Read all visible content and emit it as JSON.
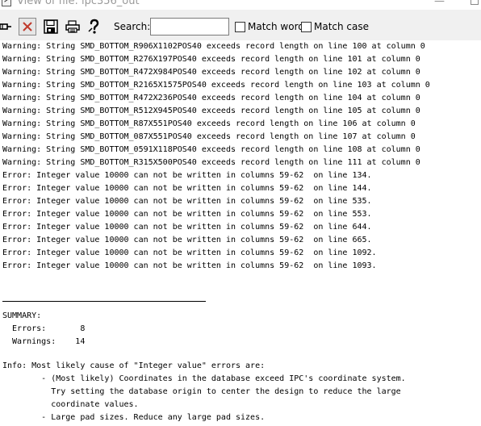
{
  "window": {
    "title": "View of file: ipc356_out",
    "minimize_glyph": "—"
  },
  "toolbar": {
    "icons": [
      "dock-icon",
      "close-icon",
      "save-icon",
      "print-icon",
      "help-icon"
    ],
    "search_label": "Search:",
    "search_value": "",
    "match_word_label": "Match word",
    "match_word_checked": false,
    "match_case_label": "Match case",
    "match_case_checked": false
  },
  "log": {
    "warnings": [
      "Warning: String SMD_BOTTOM_R906X1102POS40 exceeds record length on line 100 at column 0",
      "Warning: String SMD_BOTTOM_R276X197POS40 exceeds record length on line 101 at column 0",
      "Warning: String SMD_BOTTOM_R472X984POS40 exceeds record length on line 102 at column 0",
      "Warning: String SMD_BOTTOM_R2165X1575POS40 exceeds record length on line 103 at column 0",
      "Warning: String SMD_BOTTOM_R472X236POS40 exceeds record length on line 104 at column 0",
      "Warning: String SMD_BOTTOM_R512X945POS40 exceeds record length on line 105 at column 0",
      "Warning: String SMD_BOTTOM_R87X551POS40 exceeds record length on line 106 at column 0",
      "Warning: String SMD_BOTTOM_087X551POS40 exceeds record length on line 107 at column 0",
      "Warning: String SMD_BOTTOM_0591X118POS40 exceeds record length on line 108 at column 0",
      "Warning: String SMD_BOTTOM_R315X500POS40 exceeds record length on line 111 at column 0"
    ],
    "errors": [
      "Error: Integer value 10000 can not be written in columns 59-62  on line 134.",
      "Error: Integer value 10000 can not be written in columns 59-62  on line 144.",
      "Error: Integer value 10000 can not be written in columns 59-62  on line 535.",
      "Error: Integer value 10000 can not be written in columns 59-62  on line 553.",
      "Error: Integer value 10000 can not be written in columns 59-62  on line 644.",
      "Error: Integer value 10000 can not be written in columns 59-62  on line 665.",
      "Error: Integer value 10000 can not be written in columns 59-62  on line 1092.",
      "Error: Integer value 10000 can not be written in columns 59-62  on line 1093."
    ],
    "summary": {
      "heading": "SUMMARY:",
      "errors_line": "  Errors:       8",
      "warnings_line": "  Warnings:    14"
    },
    "info": [
      "Info: Most likely cause of \"Integer value\" errors are:",
      "        - (Most likely) Coordinates in the database exceed IPC's coordinate system.",
      "          Try setting the database origin to center the design to reduce the large",
      "          coordinate values.",
      "        - Large pad sizes. Reduce any large pad sizes."
    ]
  }
}
